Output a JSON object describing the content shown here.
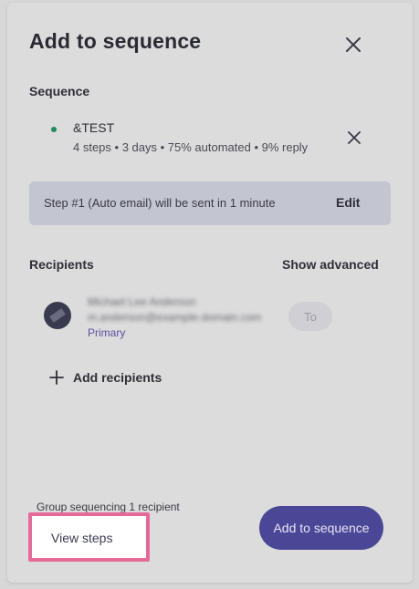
{
  "modal": {
    "title": "Add to sequence"
  },
  "sequence": {
    "section_label": "Sequence",
    "name": "&TEST",
    "meta": "4 steps • 3 days • 75% automated • 9% reply",
    "status_color": "#1f8a5f"
  },
  "notice": {
    "text": "Step #1 (Auto email) will be sent in 1 minute",
    "edit_label": "Edit"
  },
  "recipients": {
    "section_label": "Recipients",
    "show_advanced_label": "Show advanced",
    "items": [
      {
        "name": "Michael Lee Anderson",
        "email": "m.anderson@example-domain.com",
        "type": "Primary",
        "role_chip": "To"
      }
    ],
    "add_label": "Add recipients"
  },
  "footer": {
    "group_text": "Group sequencing 1 recipient",
    "view_steps_label": "View steps",
    "submit_label": "Add to sequence",
    "submit_color": "#4a4796",
    "highlight_color": "#e56a98"
  }
}
